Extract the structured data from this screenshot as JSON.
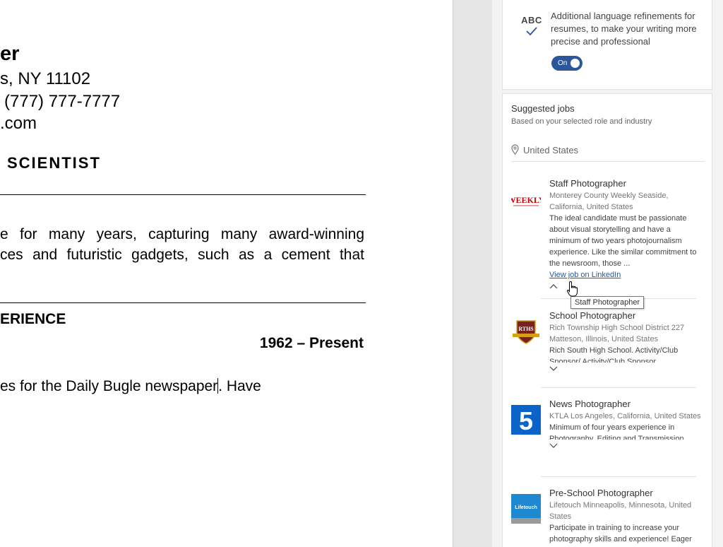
{
  "document": {
    "name_fragment": "er",
    "address_fragment": "s, NY 11102",
    "phone_fragment": "(777) 777-7777",
    "email_fragment": ".com",
    "role_fragment": "SCIENTIST",
    "summary_line1": "e for many years, capturing many award-winning",
    "summary_line2": "ces and futuristic gadgets, such as a cement that",
    "section_fragment": "ERIENCE",
    "date_range": "1962 – Present",
    "body_line_before_caret": "es for the Daily Bugle newspaper",
    "body_line_after_caret": ". Have"
  },
  "refinements": {
    "icon_label": "ABC",
    "description": "Additional language refinements for resumes, to make your writing more precise and professional",
    "toggle_label": "On",
    "toggle_on": true
  },
  "suggested_jobs": {
    "title": "Suggested jobs",
    "subtitle": "Based on your selected role and industry",
    "location": "United States",
    "jobs": [
      {
        "title": "Staff Photographer",
        "company": "Monterey County Weekly Seaside, California, United States",
        "description": "The ideal candidate must be passionate about visual storytelling and have a minimum of two years photojournalism experience. Like the similar commitment to the newsroom, those ...",
        "link": "View job on LinkedIn",
        "logo_text": "WEEKLY",
        "logo_color": "#cc0000",
        "expanded": true
      },
      {
        "title": "School Photographer",
        "company_line1": "Rich Township High School District 227",
        "company_line2": "Matteson, Illinois, United States",
        "description": "Rich South High School. Activity/Club",
        "description_faded": "Sponsor/ Activity/Club Sponsor",
        "logo_text": "RTHS",
        "logo_color": "#7a1f1f",
        "expanded": false
      },
      {
        "title": "News Photographer",
        "company": "KTLA Los Angeles, California, United States",
        "description": "Minimum of four years experience in",
        "description_faded": "Photography, Editing and Transmission",
        "logo_text": "5",
        "logo_color": "#0a63c9",
        "expanded": false
      },
      {
        "title": "Pre-School Photographer",
        "company": "Lifetouch Minneapolis, Minnesota, United States",
        "description": "Participate in training to increase your",
        "description_faded": "photography skills and experience! Eager",
        "logo_text": "Lifetouch",
        "logo_color": "#1e88d0"
      }
    ]
  },
  "tooltip": "Staff Photographer",
  "icons": {
    "check": "checkmark-icon",
    "location": "location-pin-icon",
    "collapse": "chevron-up-icon",
    "expand": "chevron-down-icon",
    "cursor": "hand-pointer-icon"
  }
}
